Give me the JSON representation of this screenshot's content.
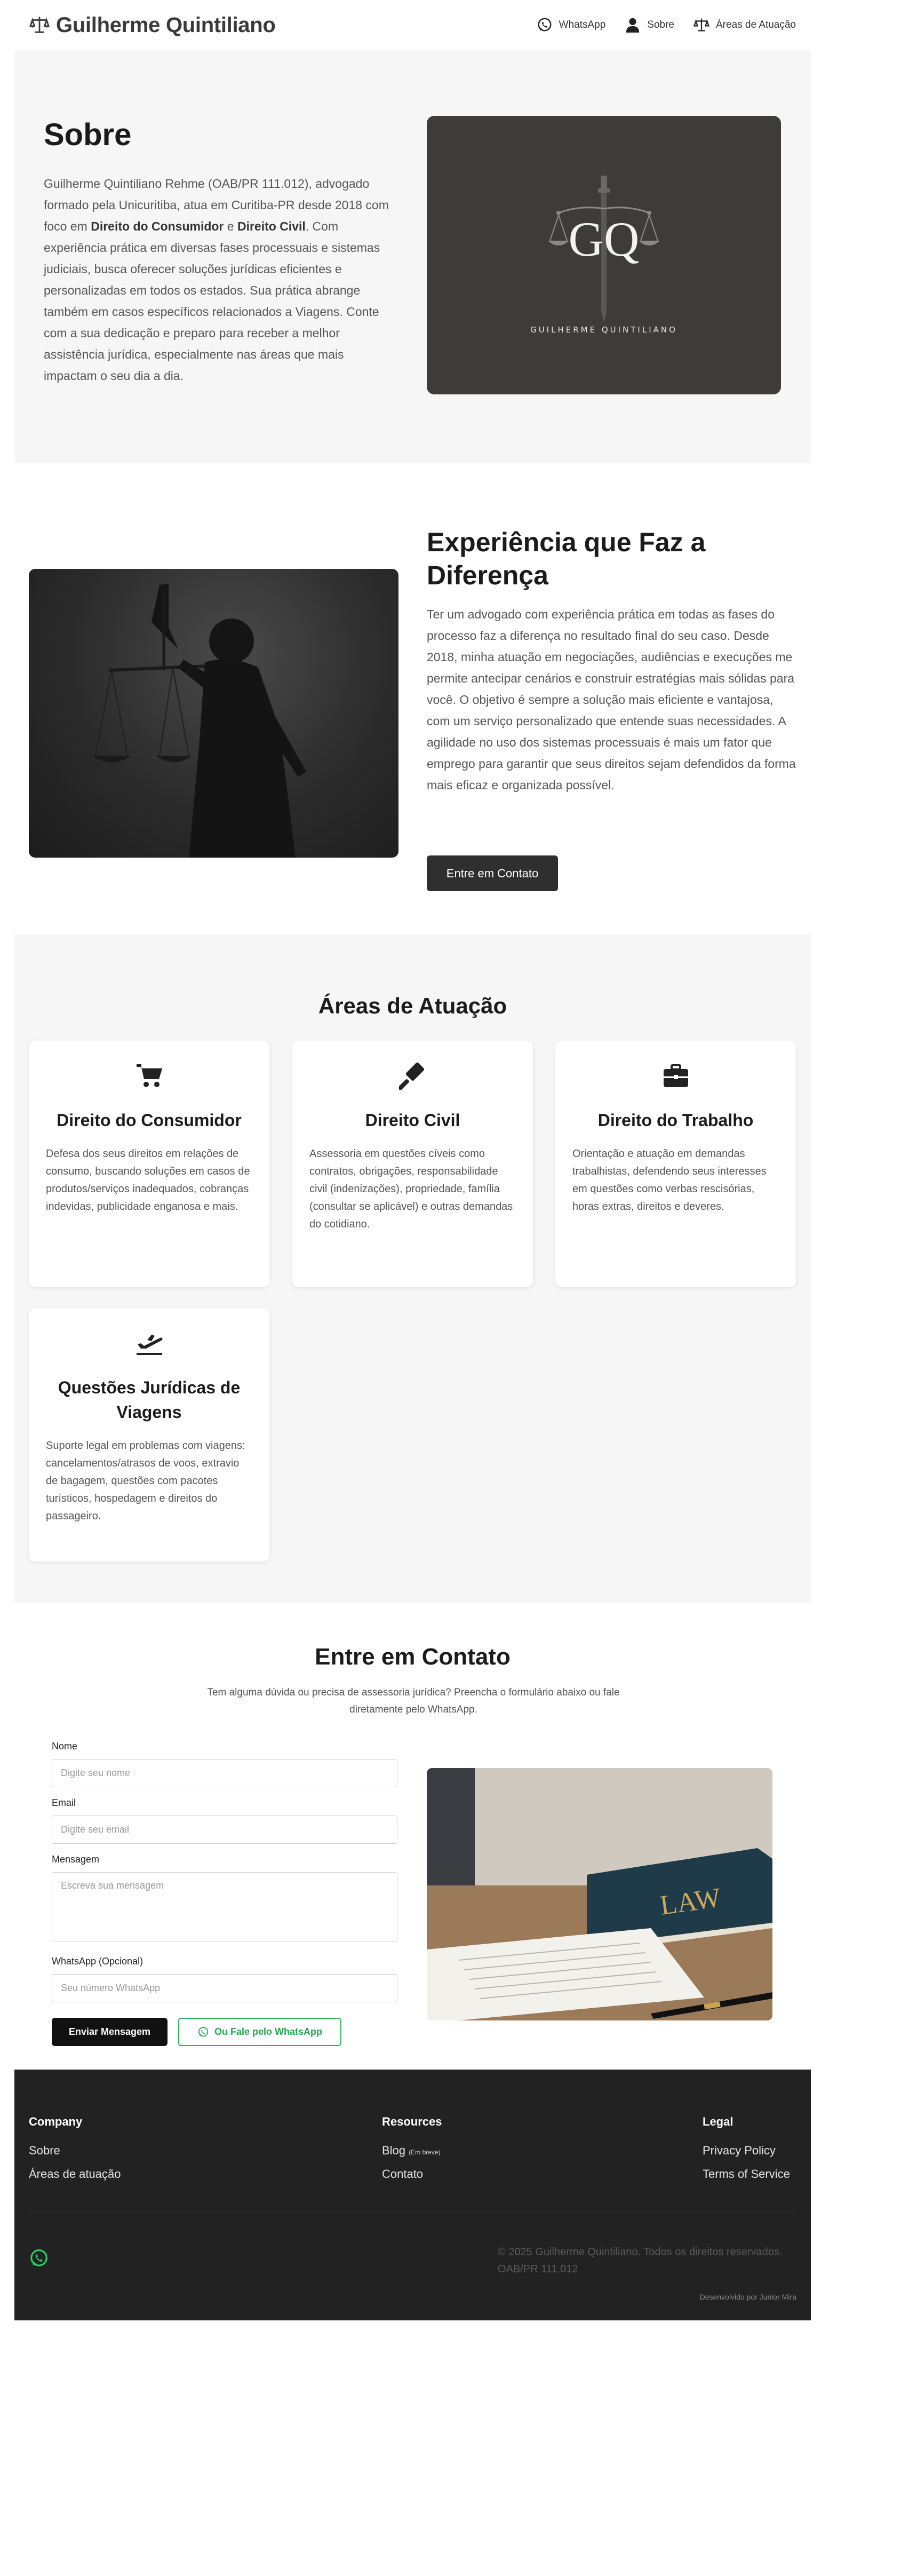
{
  "header": {
    "brand": "Guilherme Quintiliano",
    "nav": [
      {
        "label": "WhatsApp",
        "icon": "whatsapp-icon"
      },
      {
        "label": "Sobre",
        "icon": "user-icon"
      },
      {
        "label": "Áreas de Atuação",
        "icon": "scales-icon"
      }
    ]
  },
  "sobre": {
    "title": "Sobre",
    "p_part1": "Guilherme Quintiliano Rehme (OAB/PR 111.012), advogado formado pela Unicuritiba, atua em Curitiba-PR desde 2018 com foco em ",
    "bold1": "Direito do Consumidor",
    "p_part2": " e ",
    "bold2": "Direito Civil",
    "p_part3": ". Com experiência prática em diversas fases processuais e sistemas judiciais, busca oferecer soluções jurídicas eficientes e personalizadas em todos os estados. Sua prática abrange também em casos específicos relacionados a Viagens. Conte com a sua dedicação e preparo para receber a melhor assistência jurídica, especialmente nas áreas que mais impactam o seu dia a dia.",
    "logo_monogram": "GQ",
    "logo_caption": "GUILHERME QUINTILIANO"
  },
  "experiencia": {
    "title": "Experiência que Faz a Diferença",
    "paragraph": "Ter um advogado com experiência prática em todas as fases do processo faz a diferença no resultado final do seu caso. Desde 2018, minha atuação em negociações, audiências e execuções me permite antecipar cenários e construir estratégias mais sólidas para você. O objetivo é sempre a solução mais eficiente e vantajosa, com um serviço personalizado que entende suas necessidades. A agilidade no uso dos sistemas processuais é mais um fator que emprego para garantir que seus direitos sejam defendidos da forma mais eficaz e organizada possível.",
    "button": "Entre em Contato"
  },
  "areas": {
    "title": "Áreas de Atuação",
    "cards": [
      {
        "title": "Direito do Consumidor",
        "icon": "cart-icon",
        "text": "Defesa dos seus direitos em relações de consumo, buscando soluções em casos de produtos/serviços inadequados, cobranças indevidas, publicidade enganosa e mais."
      },
      {
        "title": "Direito Civil",
        "icon": "gavel-icon",
        "text": "Assessoria em questões cíveis como contratos, obrigações, responsabilidade civil (indenizações), propriedade, família (consultar se aplicável) e outras demandas do cotidiano."
      },
      {
        "title": "Direito do Trabalho",
        "icon": "briefcase-icon",
        "text": "Orientação e atuação em demandas trabalhistas, defendendo seus interesses em questões como verbas rescisórias, horas extras, direitos e deveres."
      },
      {
        "title": "Questões Jurídicas de Viagens",
        "icon": "plane-departure-icon",
        "text": "Suporte legal em problemas com viagens: cancelamentos/atrasos de voos, extravio de bagagem, questões com pacotes turísticos, hospedagem e direitos do passageiro."
      }
    ]
  },
  "contato": {
    "title": "Entre em Contato",
    "subtitle": "Tem alguma dúvida ou precisa de assessoria jurídica? Preencha o formulário abaixo ou fale diretamente pelo WhatsApp.",
    "fields": [
      {
        "label": "Nome",
        "placeholder": "Digite seu nome"
      },
      {
        "label": "Email",
        "placeholder": "Digite seu email"
      },
      {
        "label": "Mensagem",
        "placeholder": "Escreva sua mensagem"
      },
      {
        "label": "WhatsApp (Opcional)",
        "placeholder": "Seu número WhatsApp"
      }
    ],
    "send_button": "Enviar Mensagem",
    "wa_button": "Ou Fale pelo WhatsApp",
    "book_label": "LAW"
  },
  "footer": {
    "company": {
      "heading": "Company",
      "links": [
        "Sobre",
        "Áreas de atuação"
      ]
    },
    "resources": {
      "heading": "Resources",
      "blog": "Blog",
      "blog_badge": "(Em breve)",
      "contact": "Contato"
    },
    "legal": {
      "heading": "Legal",
      "links": [
        "Privacy Policy",
        "Terms of Service"
      ]
    },
    "copyright": "© 2025 Guilherme Quintiliano. Todos os direitos reservados. OAB/PR 111.012",
    "developer": "Desenvolvido por Junior Mira"
  },
  "colors": {
    "dark": "#2f2f2f",
    "whatsapp": "#25d366",
    "section_bg": "#f6f6f6",
    "footer_bg": "#222222"
  }
}
